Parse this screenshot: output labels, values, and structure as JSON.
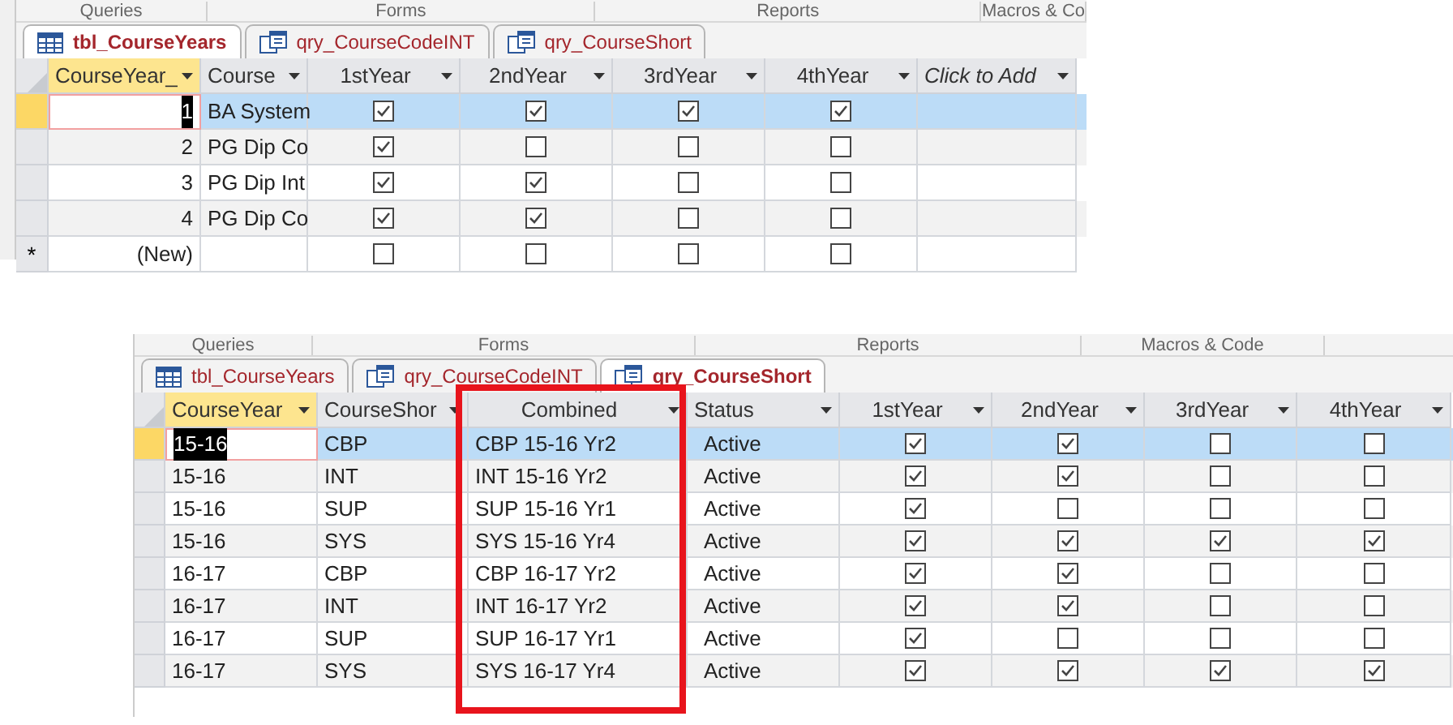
{
  "top_window": {
    "sections": [
      "Queries",
      "Forms",
      "Reports",
      "Macros & Co"
    ],
    "tabs": [
      {
        "label": "tbl_CourseYears",
        "kind": "table",
        "selected": true
      },
      {
        "label": "qry_CourseCodeINT",
        "kind": "query",
        "selected": false
      },
      {
        "label": "qry_CourseShort",
        "kind": "query",
        "selected": false
      }
    ],
    "columns": [
      {
        "label": "CourseYear_",
        "kind": "number",
        "current": true
      },
      {
        "label": "Course",
        "kind": "text",
        "current": false
      },
      {
        "label": "1stYear",
        "kind": "check",
        "current": false
      },
      {
        "label": "2ndYear",
        "kind": "check",
        "current": false
      },
      {
        "label": "3rdYear",
        "kind": "check",
        "current": false
      },
      {
        "label": "4thYear",
        "kind": "check",
        "current": false
      },
      {
        "label": "Click to Add",
        "kind": "add",
        "current": false
      }
    ],
    "rows": [
      {
        "selected": true,
        "focused": true,
        "cells": [
          "1",
          "BA System",
          true,
          true,
          true,
          true,
          ""
        ]
      },
      {
        "selected": false,
        "focused": false,
        "cells": [
          "2",
          "PG Dip Co",
          true,
          false,
          false,
          false,
          ""
        ]
      },
      {
        "selected": false,
        "focused": false,
        "cells": [
          "3",
          "PG Dip Int",
          true,
          true,
          false,
          false,
          ""
        ]
      },
      {
        "selected": false,
        "focused": false,
        "cells": [
          "4",
          "PG Dip Co",
          true,
          true,
          false,
          false,
          ""
        ]
      },
      {
        "selected": false,
        "focused": false,
        "marker": "*",
        "cells": [
          "(New)",
          "",
          false,
          false,
          false,
          false,
          ""
        ]
      }
    ]
  },
  "bottom_window": {
    "sections": [
      "Queries",
      "Forms",
      "Reports",
      "Macros & Code"
    ],
    "tabs": [
      {
        "label": "tbl_CourseYears",
        "kind": "table",
        "selected": false
      },
      {
        "label": "qry_CourseCodeINT",
        "kind": "query",
        "selected": false
      },
      {
        "label": "qry_CourseShort",
        "kind": "query",
        "selected": true
      }
    ],
    "columns": [
      {
        "label": "CourseYear",
        "kind": "text",
        "current": true
      },
      {
        "label": "CourseShor",
        "kind": "text",
        "current": false
      },
      {
        "label": "Combined",
        "kind": "center",
        "current": false
      },
      {
        "label": "Status",
        "kind": "text",
        "current": false
      },
      {
        "label": "1stYear",
        "kind": "check",
        "current": false
      },
      {
        "label": "2ndYear",
        "kind": "check",
        "current": false
      },
      {
        "label": "3rdYear",
        "kind": "check",
        "current": false
      },
      {
        "label": "4thYear",
        "kind": "check",
        "current": false
      }
    ],
    "rows": [
      {
        "selected": true,
        "focused": true,
        "cells": [
          "15-16",
          "CBP",
          "CBP 15-16 Yr2",
          "Active",
          true,
          true,
          false,
          false
        ]
      },
      {
        "selected": false,
        "focused": false,
        "cells": [
          "15-16",
          "INT",
          "INT 15-16 Yr2",
          "Active",
          true,
          true,
          false,
          false
        ]
      },
      {
        "selected": false,
        "focused": false,
        "cells": [
          "15-16",
          "SUP",
          "SUP 15-16 Yr1",
          "Active",
          true,
          false,
          false,
          false
        ]
      },
      {
        "selected": false,
        "focused": false,
        "cells": [
          "15-16",
          "SYS",
          "SYS 15-16 Yr4",
          "Active",
          true,
          true,
          true,
          true
        ]
      },
      {
        "selected": false,
        "focused": false,
        "cells": [
          "16-17",
          "CBP",
          "CBP 16-17 Yr2",
          "Active",
          true,
          true,
          false,
          false
        ]
      },
      {
        "selected": false,
        "focused": false,
        "cells": [
          "16-17",
          "INT",
          "INT 16-17 Yr2",
          "Active",
          true,
          true,
          false,
          false
        ]
      },
      {
        "selected": false,
        "focused": false,
        "cells": [
          "16-17",
          "SUP",
          "SUP 16-17 Yr1",
          "Active",
          true,
          false,
          false,
          false
        ]
      },
      {
        "selected": false,
        "focused": false,
        "cells": [
          "16-17",
          "SYS",
          "SYS 16-17 Yr4",
          "Active",
          true,
          true,
          true,
          true
        ]
      }
    ]
  }
}
